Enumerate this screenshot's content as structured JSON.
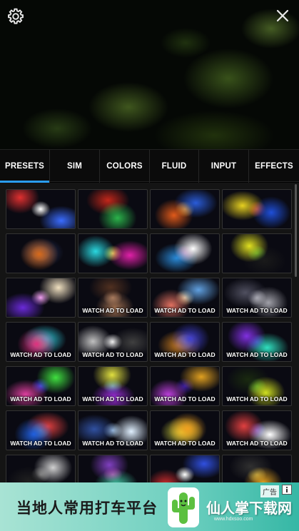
{
  "tabs": [
    {
      "label": "PRESETS",
      "active": true
    },
    {
      "label": "SIM"
    },
    {
      "label": "COLORS"
    },
    {
      "label": "FLUID"
    },
    {
      "label": "INPUT"
    },
    {
      "label": "EFFECTS"
    }
  ],
  "icons": {
    "settings": "gear-icon",
    "close": "close-icon",
    "ad_info": "info-icon"
  },
  "accent_color": "#2a9df4",
  "presets": {
    "watermark": "WATCH AD TO LOAD",
    "items": [
      {
        "locked": false,
        "colors": [
          "#e03030",
          "#3a6cff",
          "#ffffff"
        ]
      },
      {
        "locked": false,
        "colors": [
          "#2bb34a",
          "#c2271a",
          "#1a4020"
        ]
      },
      {
        "locked": false,
        "colors": [
          "#e05a1a",
          "#2a5cd8",
          "#f2c43a"
        ]
      },
      {
        "locked": false,
        "colors": [
          "#1f4fd8",
          "#e6d020",
          "#d8302a"
        ]
      },
      {
        "locked": false,
        "colors": [
          "#d86a1a",
          "#2a3a6a",
          "#f0a060"
        ]
      },
      {
        "locked": false,
        "colors": [
          "#2ad8e0",
          "#e020a8",
          "#f0e040"
        ]
      },
      {
        "locked": false,
        "colors": [
          "#ffffff",
          "#2a8ad8",
          "#d82a6a"
        ]
      },
      {
        "locked": false,
        "colors": [
          "#e0e020",
          "#1a1a1a",
          "#40d040"
        ]
      },
      {
        "locked": false,
        "colors": [
          "#f0e0c0",
          "#6a2ad8",
          "#f0a0f0"
        ]
      },
      {
        "locked": true,
        "colors": [
          "#a07050",
          "#503020",
          "#d0a080"
        ]
      },
      {
        "locked": true,
        "colors": [
          "#e07060",
          "#60a0e0",
          "#f0d0a0"
        ]
      },
      {
        "locked": true,
        "colors": [
          "#a0a0a8",
          "#505060",
          "#e0e0e8"
        ]
      },
      {
        "locked": true,
        "colors": [
          "#e03080",
          "#30d0e0",
          "#f0f040"
        ]
      },
      {
        "locked": true,
        "colors": [
          "#c0c0c0",
          "#404040",
          "#ffffff"
        ]
      },
      {
        "locked": true,
        "colors": [
          "#4040d0",
          "#d08020",
          "#f0f0f0"
        ]
      },
      {
        "locked": true,
        "colors": [
          "#8030e0",
          "#30e0c0",
          "#2040a0"
        ]
      },
      {
        "locked": true,
        "colors": [
          "#40e040",
          "#e040a0",
          "#4040e0"
        ]
      },
      {
        "locked": true,
        "colors": [
          "#e0e040",
          "#a030e0",
          "#40a0e0"
        ]
      },
      {
        "locked": true,
        "colors": [
          "#c040e0",
          "#e0a020",
          "#4020a0"
        ]
      },
      {
        "locked": true,
        "colors": [
          "#d0e020",
          "#1a2a10",
          "#40c040"
        ]
      },
      {
        "locked": true,
        "colors": [
          "#2060e0",
          "#e04040",
          "#40e0e0"
        ]
      },
      {
        "locked": true,
        "colors": [
          "#e0f0ff",
          "#3050a0",
          "#a0c0e0"
        ]
      },
      {
        "locked": true,
        "colors": [
          "#f0a020",
          "#e0e040",
          "#603000"
        ]
      },
      {
        "locked": true,
        "colors": [
          "#e04040",
          "#ffffff",
          "#4040e0"
        ]
      },
      {
        "locked": false,
        "colors": [
          "#d0d0d0",
          "#202020",
          "#808080"
        ]
      },
      {
        "locked": false,
        "colors": [
          "#8040c0",
          "#40c0a0",
          "#e060a0"
        ]
      },
      {
        "locked": false,
        "colors": [
          "#e03030",
          "#3050e0",
          "#ffffff"
        ]
      },
      {
        "locked": false,
        "colors": [
          "#e0a020",
          "#303030",
          "#f0e060"
        ]
      }
    ]
  },
  "ad": {
    "text": "当地人常用打车平台",
    "label": "广告",
    "brand": "仙人掌下载网",
    "url": "www.hdxsoo.com",
    "bg_color": "#6fd0c0"
  }
}
